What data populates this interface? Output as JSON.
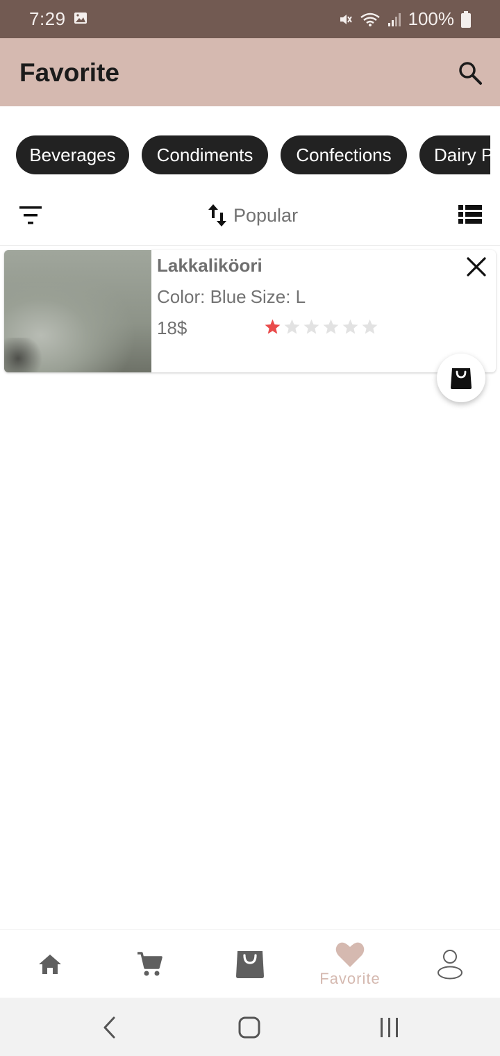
{
  "status": {
    "time": "7:29",
    "battery": "100%"
  },
  "app_bar": {
    "title": "Favorite",
    "search_icon": "search-icon"
  },
  "categories": [
    "Beverages",
    "Condiments",
    "Confections",
    "Dairy Products"
  ],
  "toolbar": {
    "filter_icon": "filter-icon",
    "sort_label": "Popular",
    "view_icon": "list-view-icon"
  },
  "favorites": [
    {
      "name": "Lakkaliköori",
      "color_label": "Color: Blue",
      "size_label": "Size: L",
      "price": "18$",
      "rating": 1,
      "max_rating": 6
    }
  ],
  "bottom_nav": {
    "items": [
      "home-icon",
      "cart-icon",
      "shop-bag-icon",
      "favorite-icon",
      "profile-icon"
    ],
    "active": 3,
    "active_label": "Favorite"
  },
  "colors": {
    "status_bar": "#725a52",
    "app_bar": "#d5b9b0",
    "accent": "#d5b9b0",
    "chip_bg": "#222222",
    "star_filled": "#e94b4b",
    "star_empty": "#e2e2e2"
  }
}
